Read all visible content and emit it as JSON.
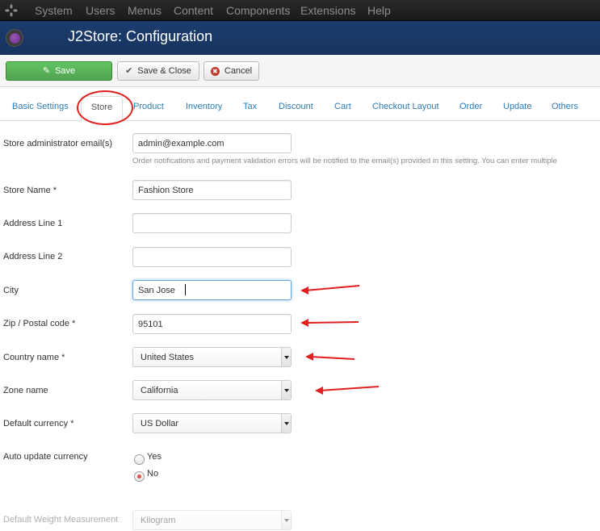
{
  "topmenu": {
    "items": [
      "System",
      "Users",
      "Menus",
      "Content",
      "Components",
      "Extensions",
      "Help"
    ]
  },
  "header": {
    "title": "J2Store: Configuration"
  },
  "toolbar": {
    "save_label": "Save",
    "save_close_label": "Save & Close",
    "cancel_label": "Cancel"
  },
  "tabs": {
    "items": [
      "Basic Settings",
      "Store",
      "Product",
      "Inventory",
      "Tax",
      "Discount",
      "Cart",
      "Checkout Layout",
      "Order",
      "Update",
      "Others"
    ],
    "active": "Store"
  },
  "form": {
    "admin_email": {
      "label": "Store administrator email(s)",
      "value": "admin@example.com",
      "help": "Order notifications and payment validation errors will be notified to the email(s) provided in this setting. You can enter multiple"
    },
    "store_name": {
      "label": "Store Name *",
      "value": "Fashion Store"
    },
    "address1": {
      "label": "Address Line 1",
      "value": ""
    },
    "address2": {
      "label": "Address Line 2",
      "value": ""
    },
    "city": {
      "label": "City",
      "value": "San Jose"
    },
    "zip": {
      "label": "Zip / Postal code *",
      "value": "95101"
    },
    "country": {
      "label": "Country name *",
      "value": "United States"
    },
    "zone": {
      "label": "Zone name",
      "value": "California"
    },
    "currency": {
      "label": "Default currency *",
      "value": "US Dollar"
    },
    "auto_update": {
      "label": "Auto update currency",
      "options": [
        "Yes",
        "No"
      ],
      "selected": "No"
    },
    "weight": {
      "label": "Default Weight Measurement",
      "value": "Kilogram"
    }
  },
  "colors": {
    "header_bg": "#17335e",
    "save_green": "#5cb85c",
    "link_blue": "#2b7bb9",
    "annotation_red": "#e02020"
  }
}
